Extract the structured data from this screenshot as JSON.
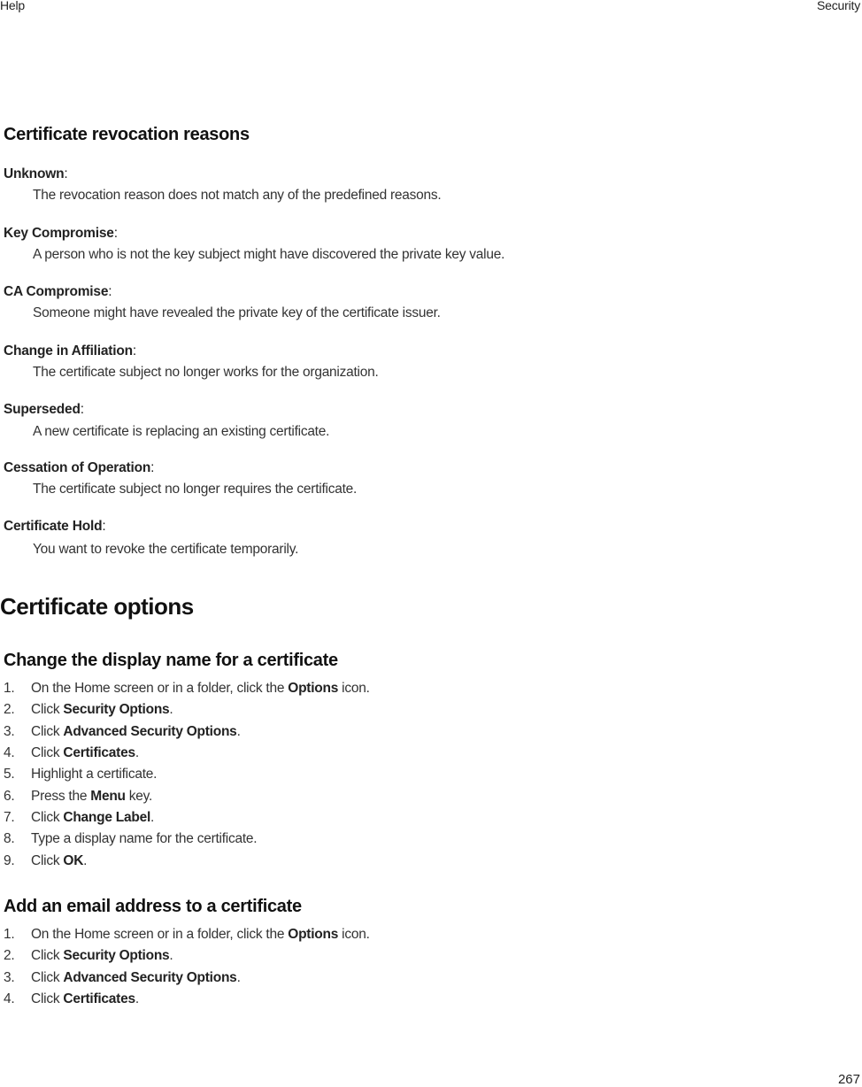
{
  "header": {
    "left": "Help",
    "right": "Security"
  },
  "revocation": {
    "title": "Certificate revocation reasons",
    "items": [
      {
        "term": "Unknown",
        "colon": ":",
        "definition": "The revocation reason does not match any of the predefined reasons."
      },
      {
        "term": "Key Compromise",
        "colon": ":",
        "definition": "A person who is not the key subject might have discovered the private key value."
      },
      {
        "term": "CA Compromise",
        "colon": ":",
        "definition": "Someone might have revealed the private key of the certificate issuer."
      },
      {
        "term": "Change in Affiliation",
        "colon": ":",
        "definition": "The certificate subject no longer works for the organization."
      },
      {
        "term": "Superseded",
        "colon": ":",
        "definition": "A new certificate is replacing an existing certificate."
      },
      {
        "term": "Cessation of Operation",
        "colon": ":",
        "definition": "The certificate subject no longer requires the certificate."
      },
      {
        "term": "Certificate Hold",
        "colon": ":",
        "definition": "You want to revoke the certificate temporarily."
      }
    ]
  },
  "options": {
    "title": "Certificate options",
    "display_name": {
      "title": "Change the display name for a certificate",
      "steps": [
        {
          "num": "1.",
          "pre": "On the Home screen or in a folder, click the ",
          "bold": "Options",
          "post": " icon."
        },
        {
          "num": "2.",
          "pre": "Click ",
          "bold": "Security Options",
          "post": "."
        },
        {
          "num": "3.",
          "pre": "Click ",
          "bold": "Advanced Security Options",
          "post": "."
        },
        {
          "num": "4.",
          "pre": "Click ",
          "bold": "Certificates",
          "post": "."
        },
        {
          "num": "5.",
          "pre": "Highlight a certificate.",
          "bold": "",
          "post": ""
        },
        {
          "num": "6.",
          "pre": "Press the ",
          "bold": "Menu",
          "post": " key."
        },
        {
          "num": "7.",
          "pre": "Click ",
          "bold": "Change Label",
          "post": "."
        },
        {
          "num": "8.",
          "pre": "Type a display name for the certificate.",
          "bold": "",
          "post": ""
        },
        {
          "num": "9.",
          "pre": "Click ",
          "bold": "OK",
          "post": "."
        }
      ]
    },
    "email": {
      "title": "Add an email address to a certificate",
      "steps": [
        {
          "num": "1.",
          "pre": "On the Home screen or in a folder, click the ",
          "bold": "Options",
          "post": " icon."
        },
        {
          "num": "2.",
          "pre": "Click ",
          "bold": "Security Options",
          "post": "."
        },
        {
          "num": "3.",
          "pre": "Click ",
          "bold": "Advanced Security Options",
          "post": "."
        },
        {
          "num": "4.",
          "pre": "Click ",
          "bold": "Certificates",
          "post": "."
        }
      ]
    }
  },
  "footer": {
    "page_number": "267"
  }
}
